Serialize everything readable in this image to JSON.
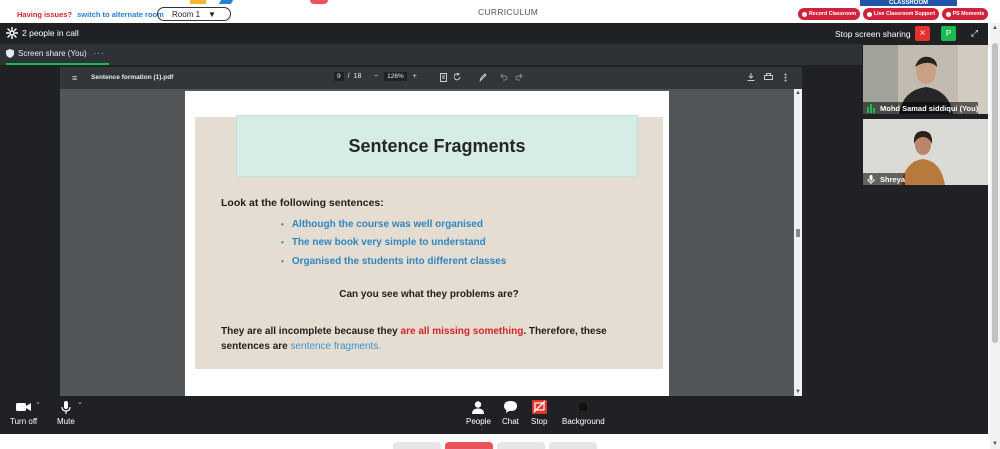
{
  "portal": {
    "issues_text": "Having issues?",
    "alternate_link": "switch to alternate room",
    "room_label": "Room 1",
    "room_caret": "▼",
    "center_title": "CURRICULUM",
    "banner_text": "CLASSROOM",
    "buttons": [
      {
        "label": "Record Classroom"
      },
      {
        "label": "Live Classroom Support"
      },
      {
        "label": "PS Moments"
      }
    ]
  },
  "meeting": {
    "people_in_call": "2 people in call",
    "stop_sharing_label": "Stop screen sharing",
    "stop_icon": "×",
    "self_avatar_letter": "P",
    "expand_icon": "⤢",
    "share_tab_label": "Screen share (You)",
    "share_tab_more": "···"
  },
  "pdf": {
    "menu_icon": "≡",
    "file_name": "Sentence formation (1).pdf",
    "current_page": "9",
    "page_sep": "/",
    "total_pages": "18",
    "zoom_minus": "−",
    "zoom_value": "126%",
    "zoom_plus": "+"
  },
  "slide": {
    "title": "Sentence Fragments",
    "intro": "Look at the following sentences:",
    "bullet_char": "•",
    "bullets": [
      "Although the course was well organised",
      "The new book very simple to understand",
      "Organised the students into different classes"
    ],
    "question": "Can you see what they problems are?",
    "answer_part1": "They are all incomplete because they ",
    "answer_red": "are all missing something",
    "answer_part2": ". Therefore, these sentences are ",
    "answer_blue": "sentence fragments."
  },
  "participants": [
    {
      "name": "Mohd Samad siddiqui (You)"
    },
    {
      "name": "Shreya"
    }
  ],
  "controls": {
    "video_label": "Turn off",
    "mic_label": "Mute",
    "people_label": "People",
    "chat_label": "Chat",
    "stop_label": "Stop",
    "background_label": "Background",
    "caret": "⌄"
  },
  "colors": {
    "accent_red": "#d0233b",
    "share_green": "#1db954",
    "link_blue": "#2a7fd4",
    "slide_blue": "#2f86c1"
  }
}
